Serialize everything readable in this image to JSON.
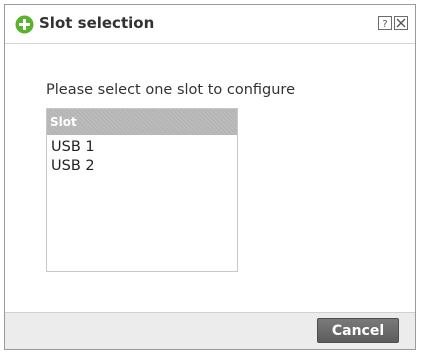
{
  "dialog": {
    "title": "Slot selection",
    "icon": "plus-circle-icon",
    "accent_color": "#5cb130",
    "title_buttons": {
      "help": "?",
      "close": "×"
    }
  },
  "prompt": "Please select one slot to configure",
  "slot_table": {
    "header": "Slot",
    "header_color": "#b5b5b5",
    "rows": [
      "USB 1",
      "USB 2"
    ]
  },
  "footer": {
    "cancel_label": "Cancel",
    "button_color": "#666666"
  }
}
